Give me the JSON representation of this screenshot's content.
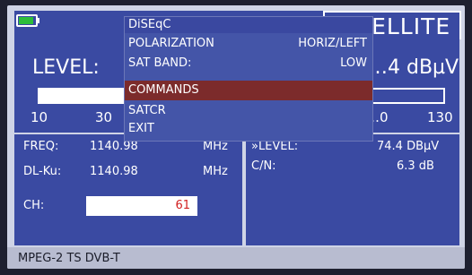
{
  "header": {
    "mode_title": "…TELLITE",
    "battery_color": "#2dbd3a"
  },
  "level": {
    "label": "LEVEL:",
    "value": "…4 dBµV",
    "scale": [
      "10",
      "30",
      "…0",
      "130"
    ]
  },
  "freq_panel": {
    "freq_label": "FREQ:",
    "freq_value": "1140.98",
    "freq_unit": "MHz",
    "dlku_label": "DL-Ku:",
    "dlku_value": "1140.98",
    "dlku_unit": "MHz",
    "ch_label": "CH:",
    "ch_value": "61"
  },
  "level_panel": {
    "level_label": "»LEVEL:",
    "level_value": "74.4 DBµV",
    "cn_label": "C/N:",
    "cn_value": "6.3 dB"
  },
  "status": {
    "mode": "MPEG-2 TS DVB-T"
  },
  "menu": {
    "title": "DiSEqC",
    "items": [
      {
        "label": "POLARIZATION",
        "value": "HORIZ/LEFT"
      },
      {
        "label": "SAT BAND:",
        "value": "LOW"
      },
      {
        "label": "COMMANDS",
        "value": ""
      },
      {
        "label": "SATCR",
        "value": ""
      },
      {
        "label": "EXIT",
        "value": ""
      }
    ],
    "selected_index": 2,
    "selected_color": "#7c2b2b"
  }
}
